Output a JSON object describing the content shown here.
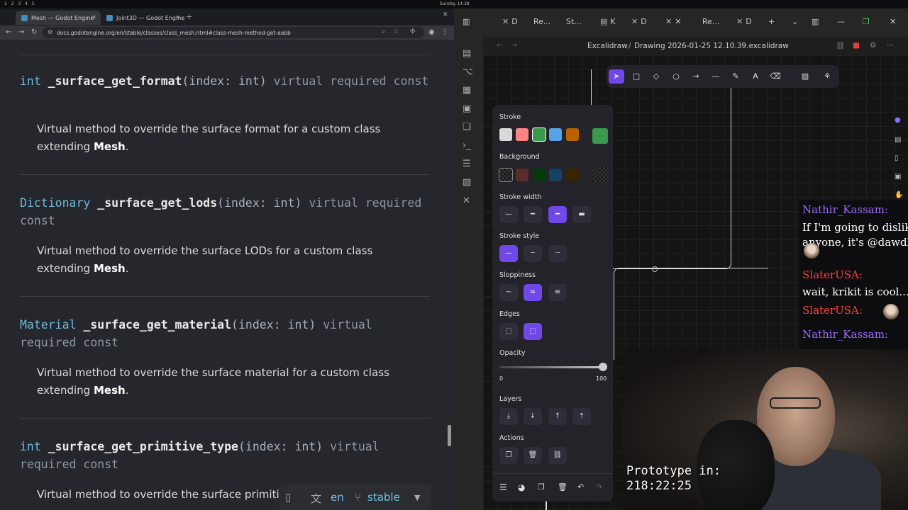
{
  "system": {
    "workspaces": "1 2 3 4 5",
    "clock": "Sunday 14:38"
  },
  "browser": {
    "tabs": [
      {
        "label": "Mesh — Godot Engine",
        "active": true
      },
      {
        "label": "Joint3D — Godot Engine",
        "active": false
      }
    ],
    "url": "docs.godotengine.org/en/stable/classes/class_mesh.html#class-mesh-method-get-aabb",
    "methods": [
      {
        "ret": "int",
        "name": "_surface_get_format",
        "args": "(index: int)",
        "q1": "virtual",
        "q2": "required",
        "q3": "const",
        "desc": "Virtual method to override the surface format for a custom class extending",
        "cls": "Mesh",
        "end": "."
      },
      {
        "ret": "Dictionary",
        "name": "_surface_get_lods",
        "args": "(index: int)",
        "q1": "virtual",
        "q2": "required",
        "q3": "const",
        "desc": "Virtual method to override the surface LODs for a custom class extending",
        "cls": "Mesh",
        "end": "."
      },
      {
        "ret": "Material",
        "name": "_surface_get_material",
        "args": "(index: int)",
        "q1": "virtual",
        "q2": "required",
        "q3": "const",
        "desc": "Virtual method to override the surface material for a custom class extending",
        "cls": "Mesh",
        "end": "."
      },
      {
        "ret": "int",
        "name": "_surface_get_primitive_type",
        "args": "(index: int)",
        "q1": "virtual",
        "q2": "required",
        "q3": "const",
        "desc": "Virtual method to override the surface primitive type for a custom class",
        "cls": "",
        "end": ""
      }
    ],
    "version_panel": {
      "lang": "en",
      "branch": "stable"
    }
  },
  "app": {
    "tabs": [
      {
        "icon": "✕",
        "label": "D"
      },
      {
        "icon": "",
        "label": "Re..."
      },
      {
        "icon": "",
        "label": "St..."
      },
      {
        "icon": "▤",
        "label": "K"
      },
      {
        "icon": "✕",
        "label": "D"
      },
      {
        "icon": "✕",
        "label": "✕"
      },
      {
        "icon": "",
        "label": "Re..."
      },
      {
        "icon": "✕",
        "label": "D"
      }
    ],
    "breadcrumb_parent": "Excalidraw",
    "breadcrumb_sep": "/",
    "file_title": "Drawing 2026-01-25 12.10.39.excalidraw",
    "props": {
      "stroke_label": "Stroke",
      "background_label": "Background",
      "stroke_width_label": "Stroke width",
      "stroke_style_label": "Stroke style",
      "sloppiness_label": "Sloppiness",
      "edges_label": "Edges",
      "opacity_label": "Opacity",
      "opacity_min": "0",
      "opacity_max": "100",
      "opacity_value": 100,
      "layers_label": "Layers",
      "actions_label": "Actions",
      "stroke_colors": [
        "#d9d9d9",
        "#ff8383",
        "#3a994c",
        "#56a2e8",
        "#b76100",
        "#3a994c"
      ],
      "bg_colors": [
        "#2a2a2a",
        "#5b2c2c",
        "#043b0c",
        "#154163",
        "#362500",
        "#2a2a2a"
      ]
    },
    "chat": [
      {
        "user": "Nathir_Kassam:",
        "color": "#9b6bff",
        "text": "If I'm going to dislike anyone, it's @dawdle"
      },
      {
        "user": "SlaterUSA:",
        "color": "#ff3b3b",
        "text": "wait, krikit is cool...?"
      },
      {
        "user": "SlaterUSA:",
        "color": "#ff3b3b",
        "text": ""
      },
      {
        "user": "Nathir_Kassam:",
        "color": "#9b6bff",
        "text": ""
      }
    ],
    "overlay_line1": "Prototype in:",
    "overlay_line2": "218:22:25"
  }
}
